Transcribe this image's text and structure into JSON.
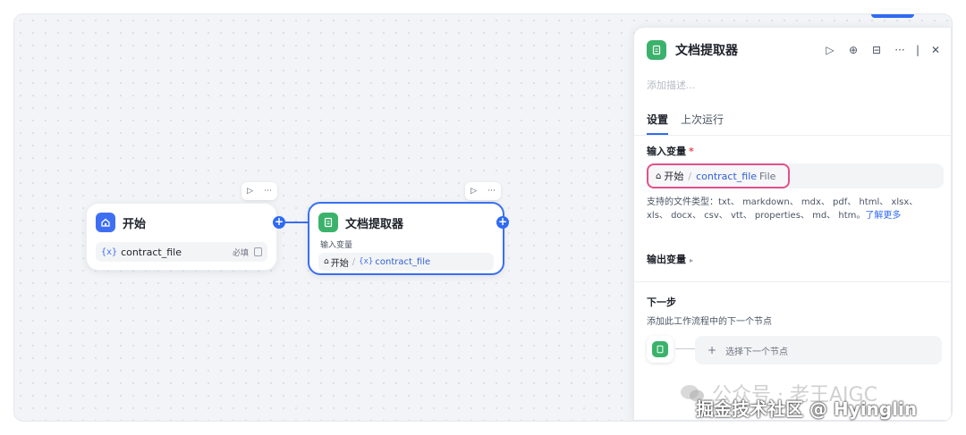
{
  "canvas": {
    "start_node": {
      "title": "开始",
      "variable": "contract_file",
      "var_prefix": "{x}",
      "required_label": "必填"
    },
    "doc_node": {
      "title": "文档提取器",
      "input_label": "输入变量",
      "source": "开始",
      "var_prefix": "{x}",
      "variable": "contract_file"
    }
  },
  "panel": {
    "title": "文档提取器",
    "description_placeholder": "添加描述...",
    "tabs": [
      {
        "label": "设置",
        "active": true
      },
      {
        "label": "上次运行",
        "active": false
      }
    ],
    "input_section": {
      "label": "输入变量",
      "required_mark": "*",
      "source": "开始",
      "variable": "contract_file",
      "type": "File"
    },
    "supported_types": "支持的文件类型：txt、 markdown、 mdx、 pdf、 html、 xlsx、 xls、 docx、 csv、 vtt、 properties、 md、 htm。",
    "learn_more": "了解更多",
    "output_section": {
      "label": "输出变量"
    },
    "next_step": {
      "label": "下一步",
      "description": "添加此工作流程中的下一个节点",
      "select_label": "选择下一个节点"
    }
  },
  "watermarks": {
    "account": "公众号 · 老王AIGC",
    "community": "掘金技术社区 @ Hyinglin"
  },
  "colors": {
    "accent": "#2f6bf2",
    "start_icon": "#3e6ff3",
    "doc_icon": "#3bb26b",
    "highlight_border": "#e4508a"
  }
}
